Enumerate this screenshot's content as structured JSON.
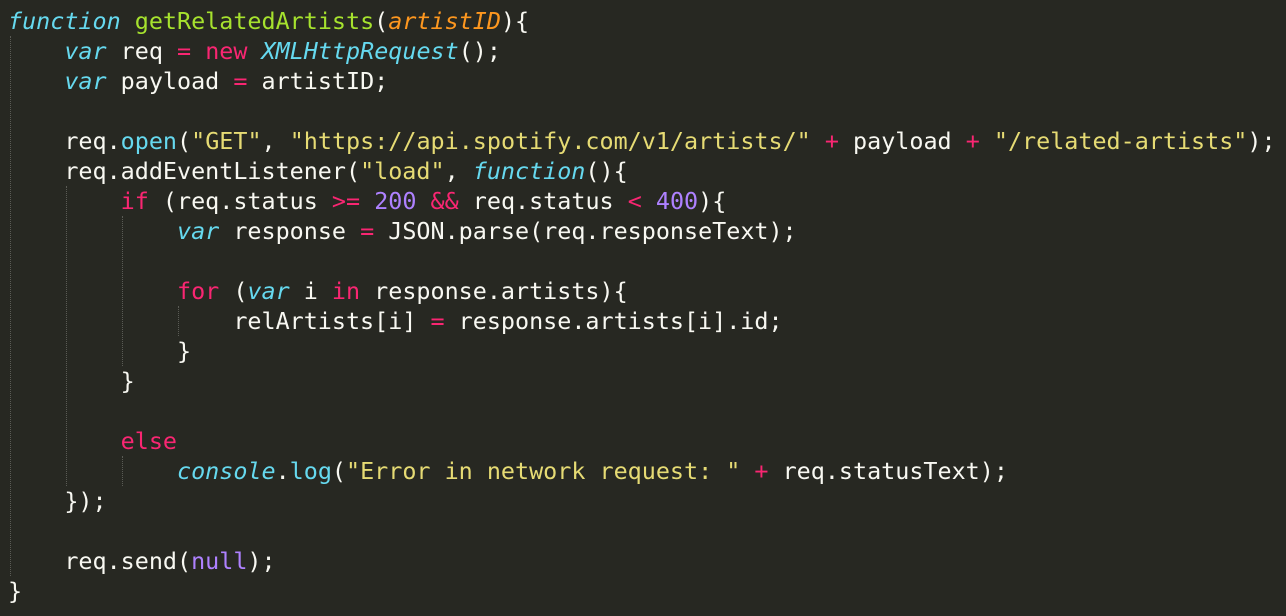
{
  "editor": {
    "theme": "monokai",
    "colors": {
      "background": "#272822",
      "foreground": "#f8f8f2",
      "keyword": "#f92672",
      "storage": "#66d9ef",
      "function_name": "#a6e22e",
      "parameter": "#fd971f",
      "string": "#e6db74",
      "number": "#ae81ff"
    },
    "lines": [
      [
        [
          "kw-storage",
          "function"
        ],
        [
          "plain",
          " "
        ],
        [
          "fn",
          "getRelatedArtists"
        ],
        [
          "plain",
          "("
        ],
        [
          "param",
          "artistID"
        ],
        [
          "plain",
          "){"
        ]
      ],
      [
        [
          "plain",
          "    "
        ],
        [
          "kw-storage",
          "var"
        ],
        [
          "plain",
          " req "
        ],
        [
          "kw",
          "="
        ],
        [
          "plain",
          " "
        ],
        [
          "kw",
          "new"
        ],
        [
          "plain",
          " "
        ],
        [
          "cls",
          "XMLHttpRequest"
        ],
        [
          "plain",
          "();"
        ]
      ],
      [
        [
          "plain",
          "    "
        ],
        [
          "kw-storage",
          "var"
        ],
        [
          "plain",
          " payload "
        ],
        [
          "kw",
          "="
        ],
        [
          "plain",
          " artistID;"
        ]
      ],
      [
        [
          "plain",
          ""
        ]
      ],
      [
        [
          "plain",
          "    req."
        ],
        [
          "method",
          "open"
        ],
        [
          "plain",
          "("
        ],
        [
          "str",
          "\"GET\""
        ],
        [
          "plain",
          ", "
        ],
        [
          "str",
          "\"https://api.spotify.com/v1/artists/\""
        ],
        [
          "plain",
          " "
        ],
        [
          "kw",
          "+"
        ],
        [
          "plain",
          " payload "
        ],
        [
          "kw",
          "+"
        ],
        [
          "plain",
          " "
        ],
        [
          "str",
          "\"/related-artists\""
        ],
        [
          "plain",
          ");"
        ]
      ],
      [
        [
          "plain",
          "    req.addEventListener("
        ],
        [
          "str",
          "\"load\""
        ],
        [
          "plain",
          ", "
        ],
        [
          "kw-storage",
          "function"
        ],
        [
          "plain",
          "(){"
        ]
      ],
      [
        [
          "plain",
          "        "
        ],
        [
          "kw",
          "if"
        ],
        [
          "plain",
          " (req.status "
        ],
        [
          "kw",
          ">="
        ],
        [
          "plain",
          " "
        ],
        [
          "num",
          "200"
        ],
        [
          "plain",
          " "
        ],
        [
          "kw",
          "&&"
        ],
        [
          "plain",
          " req.status "
        ],
        [
          "kw",
          "<"
        ],
        [
          "plain",
          " "
        ],
        [
          "num",
          "400"
        ],
        [
          "plain",
          "){"
        ]
      ],
      [
        [
          "plain",
          "            "
        ],
        [
          "kw-storage",
          "var"
        ],
        [
          "plain",
          " response "
        ],
        [
          "kw",
          "="
        ],
        [
          "plain",
          " JSON.parse(req.responseText);"
        ]
      ],
      [
        [
          "plain",
          ""
        ]
      ],
      [
        [
          "plain",
          "            "
        ],
        [
          "kw",
          "for"
        ],
        [
          "plain",
          " ("
        ],
        [
          "kw-storage",
          "var"
        ],
        [
          "plain",
          " i "
        ],
        [
          "kw",
          "in"
        ],
        [
          "plain",
          " response.artists){"
        ]
      ],
      [
        [
          "plain",
          "                relArtists[i] "
        ],
        [
          "kw",
          "="
        ],
        [
          "plain",
          " response.artists[i].id;"
        ]
      ],
      [
        [
          "plain",
          "            }"
        ]
      ],
      [
        [
          "plain",
          "        }"
        ]
      ],
      [
        [
          "plain",
          ""
        ]
      ],
      [
        [
          "plain",
          "        "
        ],
        [
          "kw",
          "else"
        ]
      ],
      [
        [
          "plain",
          "            "
        ],
        [
          "builtin",
          "console"
        ],
        [
          "plain",
          "."
        ],
        [
          "method",
          "log"
        ],
        [
          "plain",
          "("
        ],
        [
          "str",
          "\"Error in network request: \""
        ],
        [
          "plain",
          " "
        ],
        [
          "kw",
          "+"
        ],
        [
          "plain",
          " req.statusText);"
        ]
      ],
      [
        [
          "plain",
          "    });"
        ]
      ],
      [
        [
          "plain",
          ""
        ]
      ],
      [
        [
          "plain",
          "    req.send("
        ],
        [
          "const",
          "null"
        ],
        [
          "plain",
          ");"
        ]
      ],
      [
        [
          "plain",
          "}"
        ]
      ]
    ]
  }
}
